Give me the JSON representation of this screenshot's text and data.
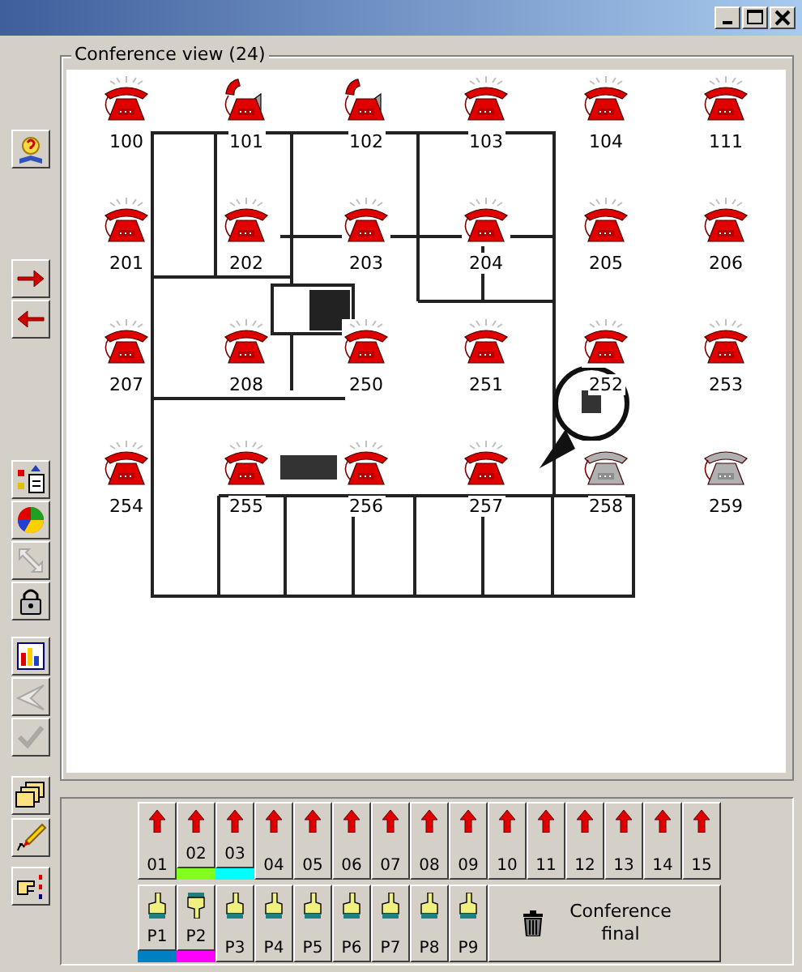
{
  "conference_view": {
    "title": "Conference view (24)",
    "phones": [
      {
        "number": "100",
        "kind": "ringing"
      },
      {
        "number": "101",
        "kind": "speaker"
      },
      {
        "number": "102",
        "kind": "speaker"
      },
      {
        "number": "103",
        "kind": "ringing"
      },
      {
        "number": "104",
        "kind": "ringing"
      },
      {
        "number": "111",
        "kind": "ringing"
      },
      {
        "number": "201",
        "kind": "ringing"
      },
      {
        "number": "202",
        "kind": "ringing"
      },
      {
        "number": "203",
        "kind": "ringing"
      },
      {
        "number": "204",
        "kind": "ringing"
      },
      {
        "number": "205",
        "kind": "ringing"
      },
      {
        "number": "206",
        "kind": "ringing"
      },
      {
        "number": "207",
        "kind": "ringing"
      },
      {
        "number": "208",
        "kind": "ringing"
      },
      {
        "number": "250",
        "kind": "ringing"
      },
      {
        "number": "251",
        "kind": "ringing"
      },
      {
        "number": "252",
        "kind": "ringing"
      },
      {
        "number": "253",
        "kind": "ringing"
      },
      {
        "number": "254",
        "kind": "ringing"
      },
      {
        "number": "255",
        "kind": "ringing"
      },
      {
        "number": "256",
        "kind": "ringing"
      },
      {
        "number": "257",
        "kind": "ringing"
      },
      {
        "number": "258",
        "kind": "idle"
      },
      {
        "number": "259",
        "kind": "idle"
      }
    ]
  },
  "toolbar": [
    [
      {
        "disabled": false
      }
    ],
    [
      {
        "disabled": false
      },
      {
        "disabled": false
      }
    ],
    [
      {
        "disabled": false
      },
      {
        "disabled": false
      },
      {
        "disabled": true
      },
      {
        "disabled": false
      }
    ],
    [
      {
        "disabled": false
      },
      {
        "disabled": true
      },
      {
        "disabled": true
      }
    ],
    [
      {
        "disabled": false
      }
    ],
    [
      {
        "disabled": false
      }
    ],
    [
      {
        "disabled": false
      }
    ]
  ],
  "lines": [
    {
      "label": "01"
    },
    {
      "label": "02",
      "color": "#80ff20"
    },
    {
      "label": "03",
      "color": "#00ffff"
    },
    {
      "label": "04"
    },
    {
      "label": "05"
    },
    {
      "label": "06"
    },
    {
      "label": "07"
    },
    {
      "label": "08"
    },
    {
      "label": "09"
    },
    {
      "label": "10"
    },
    {
      "label": "11"
    },
    {
      "label": "12"
    },
    {
      "label": "13"
    },
    {
      "label": "14"
    },
    {
      "label": "15"
    }
  ],
  "parties": [
    {
      "label": "P1",
      "kind": "raised",
      "color": "#0080c0"
    },
    {
      "label": "P2",
      "kind": "lowered",
      "color": "#ff00ff"
    },
    {
      "label": "P3",
      "kind": "raised"
    },
    {
      "label": "P4",
      "kind": "raised"
    },
    {
      "label": "P5",
      "kind": "raised"
    },
    {
      "label": "P6",
      "kind": "raised"
    },
    {
      "label": "P7",
      "kind": "raised"
    },
    {
      "label": "P8",
      "kind": "raised"
    },
    {
      "label": "P9",
      "kind": "raised"
    }
  ],
  "final_button": {
    "label": "Conference final"
  }
}
